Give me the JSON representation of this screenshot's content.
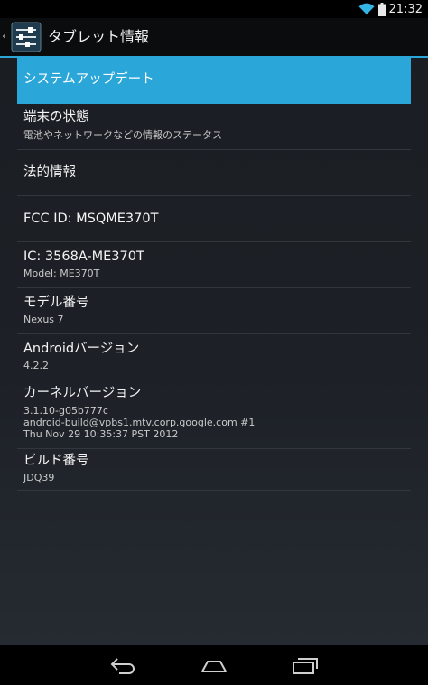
{
  "status_bar": {
    "time": "21:32",
    "icons": [
      "wifi-icon",
      "battery-icon"
    ]
  },
  "action_bar": {
    "up_glyph": "‹",
    "title": "タブレット情報",
    "icon": "settings-sliders-icon"
  },
  "items": [
    {
      "title": "システムアップデート",
      "summary": ""
    },
    {
      "title": "端末の状態",
      "summary": "電池やネットワークなどの情報のステータス"
    },
    {
      "title": "法的情報",
      "summary": ""
    },
    {
      "title": "FCC ID: MSQME370T",
      "summary": ""
    },
    {
      "title": "IC: 3568A-ME370T",
      "summary": "Model: ME370T"
    },
    {
      "title": "モデル番号",
      "summary": "Nexus 7"
    },
    {
      "title": "Androidバージョン",
      "summary": "4.2.2"
    },
    {
      "title": "カーネルバージョン",
      "summary": "3.1.10-g05b777c\nandroid-build@vpbs1.mtv.corp.google.com #1\nThu Nov 29 10:35:37 PST 2012"
    },
    {
      "title": "ビルド番号",
      "summary": "JDQ39"
    }
  ],
  "nav_bar": {
    "buttons": [
      "back-icon",
      "home-icon",
      "recent-apps-icon"
    ]
  },
  "colors": {
    "accent": "#2aa6d8",
    "background": "#1d2127",
    "divider": "#32373e"
  }
}
